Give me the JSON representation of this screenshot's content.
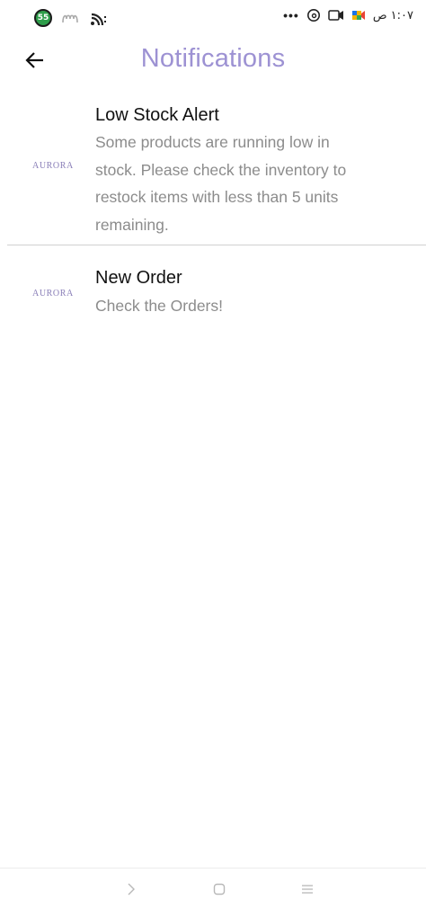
{
  "status_bar": {
    "battery_level": "55",
    "time": "١:٠٧ ص",
    "more": "•••",
    "icons_left": [
      "battery-icon",
      "tracker-icon",
      "wifi-icon"
    ],
    "icons_right": [
      "threads-icon",
      "video-icon",
      "meet-icon"
    ]
  },
  "header": {
    "title": "Notifications",
    "back_icon": "arrow-left-icon"
  },
  "notifications": [
    {
      "logo": "AURORA",
      "title": "Low Stock Alert",
      "lines": [
        "Some products are running low in",
        "stock. Please check the inventory to",
        "restock items with less than 5 units",
        "remaining."
      ]
    },
    {
      "logo": "AURORA",
      "title": "New Order",
      "lines": [
        "Check the Orders!"
      ]
    }
  ],
  "nav_bar": {
    "icons": [
      "back-nav-icon",
      "home-nav-icon",
      "recents-nav-icon"
    ]
  },
  "colors": {
    "accent": "#9d92d3",
    "body_text": "#8c8c8c",
    "title_text": "#111111",
    "battery": "#2e9d4a"
  }
}
